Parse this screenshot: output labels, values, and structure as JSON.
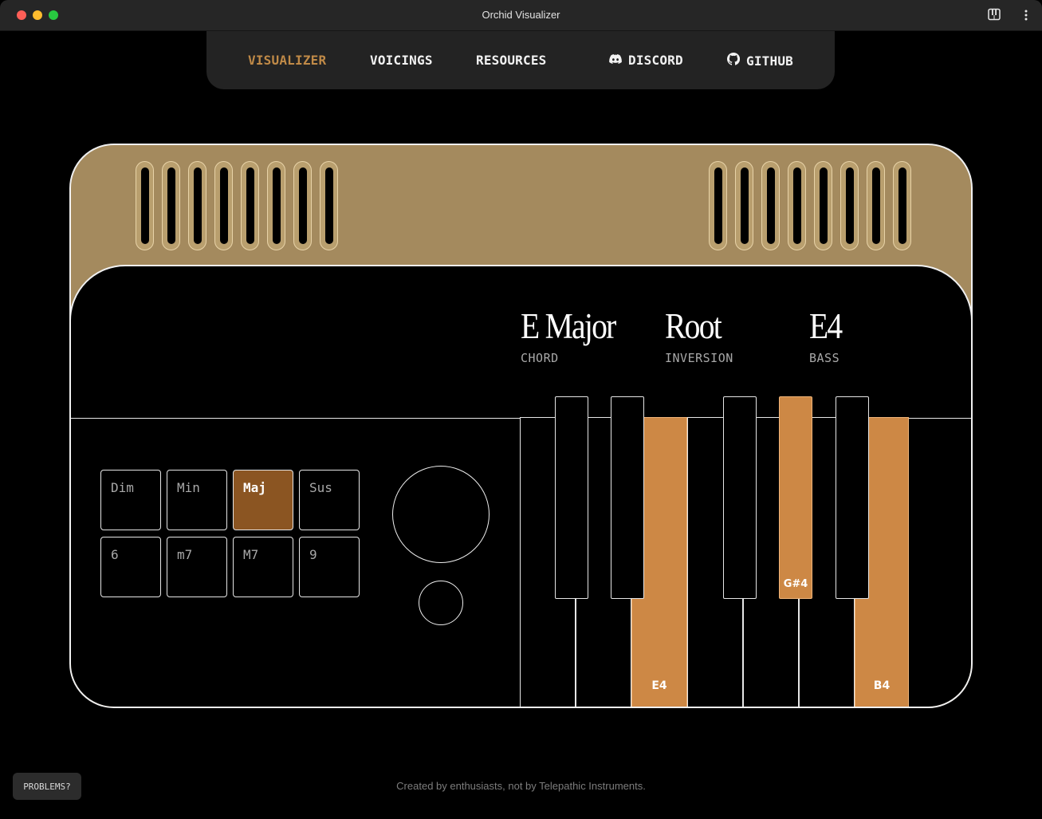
{
  "window": {
    "title": "Orchid Visualizer",
    "icons": [
      "close",
      "minimize",
      "maximize",
      "piano-icon",
      "more-vertical-icon"
    ]
  },
  "nav": {
    "items": [
      {
        "label": "VISUALIZER",
        "active": true
      },
      {
        "label": "VOICINGS",
        "active": false
      },
      {
        "label": "RESOURCES",
        "active": false
      },
      {
        "label": "DISCORD",
        "icon": "discord-icon",
        "active": false
      },
      {
        "label": "GITHUB",
        "icon": "github-icon",
        "active": false
      }
    ]
  },
  "display": {
    "chord": {
      "value": "E Major",
      "label": "CHORD"
    },
    "inversion": {
      "value": "Root",
      "label": "INVERSION"
    },
    "bass": {
      "value": "E4",
      "label": "BASS"
    }
  },
  "pads": [
    {
      "label": "Dim",
      "active": false
    },
    {
      "label": "Min",
      "active": false
    },
    {
      "label": "Maj",
      "active": true
    },
    {
      "label": "Sus",
      "active": false
    },
    {
      "label": "6",
      "active": false
    },
    {
      "label": "m7",
      "active": false
    },
    {
      "label": "M7",
      "active": false
    },
    {
      "label": "9",
      "active": false
    }
  ],
  "keyboard": {
    "highlighted_notes": [
      "E4",
      "G#4",
      "B4"
    ],
    "white_key_labels": {
      "e4": "E4",
      "b4": "B4"
    },
    "black_key_labels": {
      "gs4": "G#4"
    }
  },
  "footer": {
    "problems_button": "PROBLEMS?",
    "credit": "Created by enthusiasts, not by Telepathic Instruments."
  },
  "colors": {
    "accent": "#c08a47",
    "device_top": "#a48a5e",
    "active_pad": "#8b5522",
    "active_key": "#cd8845"
  }
}
